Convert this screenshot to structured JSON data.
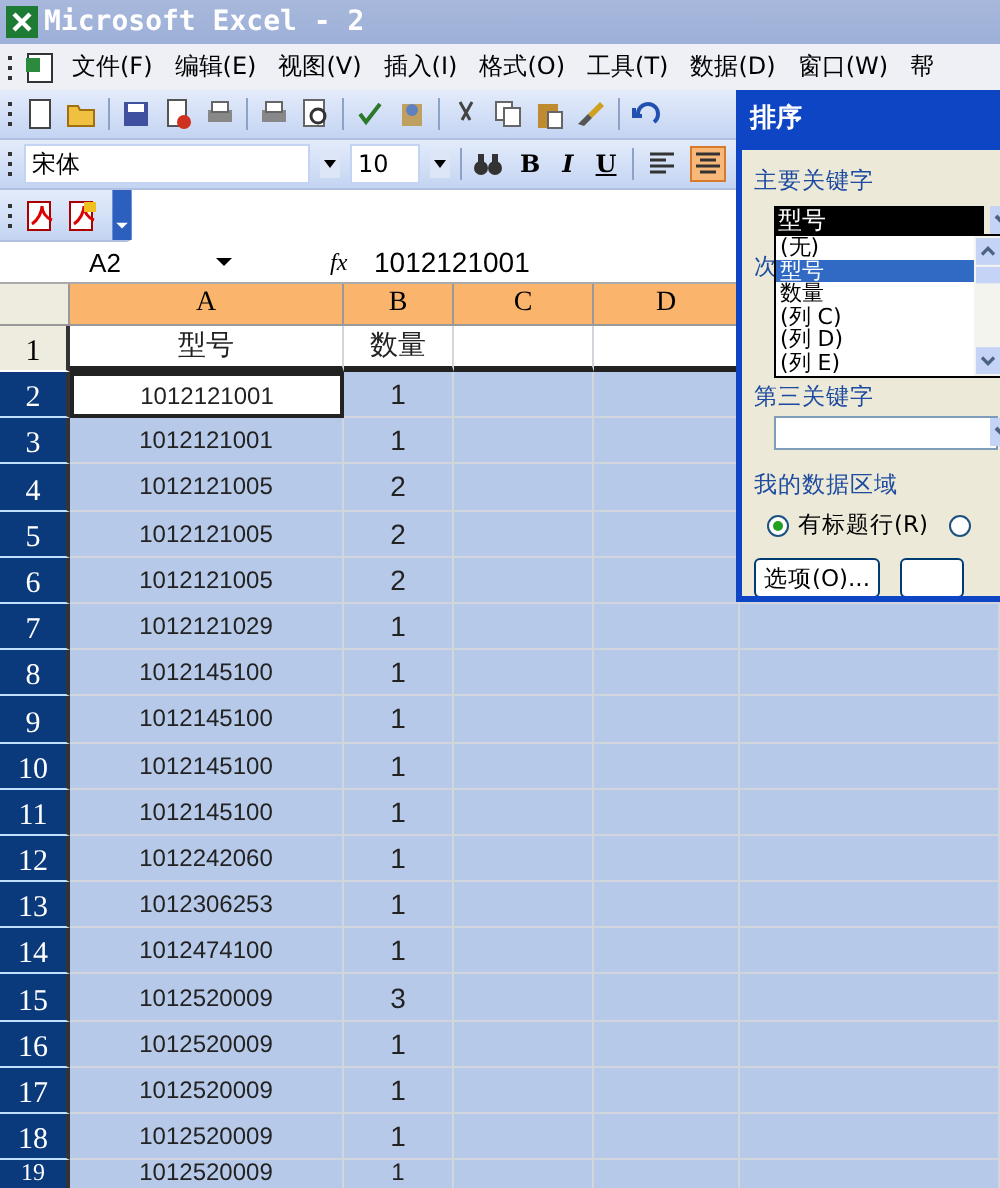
{
  "window": {
    "title": "Microsoft Excel - 2"
  },
  "menu": [
    "文件(F)",
    "编辑(E)",
    "视图(V)",
    "插入(I)",
    "格式(O)",
    "工具(T)",
    "数据(D)",
    "窗口(W)",
    "帮"
  ],
  "format_bar": {
    "font": "宋体",
    "size": "10",
    "styles": [
      "B",
      "I",
      "U"
    ],
    "align": [
      {
        "kind": "left",
        "selected": false
      },
      {
        "kind": "center",
        "selected": true
      }
    ]
  },
  "formula_bar": {
    "name_box": "A2",
    "fx": "fx",
    "value": "1012121001"
  },
  "columns": [
    "A",
    "B",
    "C",
    "D"
  ],
  "rows": [
    {
      "num": "1",
      "a": "型号",
      "b": "数量",
      "selected": false,
      "active": false
    },
    {
      "num": "2",
      "a": "1012121001",
      "b": "1",
      "selected": true,
      "active": true
    },
    {
      "num": "3",
      "a": "1012121001",
      "b": "1",
      "selected": true,
      "active": false
    },
    {
      "num": "4",
      "a": "1012121005",
      "b": "2",
      "selected": true,
      "active": false
    },
    {
      "num": "5",
      "a": "1012121005",
      "b": "2",
      "selected": true,
      "active": false
    },
    {
      "num": "6",
      "a": "1012121005",
      "b": "2",
      "selected": true,
      "active": false
    },
    {
      "num": "7",
      "a": "1012121029",
      "b": "1",
      "selected": true,
      "active": false
    },
    {
      "num": "8",
      "a": "1012145100",
      "b": "1",
      "selected": true,
      "active": false
    },
    {
      "num": "9",
      "a": "1012145100",
      "b": "1",
      "selected": true,
      "active": false
    },
    {
      "num": "10",
      "a": "1012145100",
      "b": "1",
      "selected": true,
      "active": false
    },
    {
      "num": "11",
      "a": "1012145100",
      "b": "1",
      "selected": true,
      "active": false
    },
    {
      "num": "12",
      "a": "1012242060",
      "b": "1",
      "selected": true,
      "active": false
    },
    {
      "num": "13",
      "a": "1012306253",
      "b": "1",
      "selected": true,
      "active": false
    },
    {
      "num": "14",
      "a": "1012474100",
      "b": "1",
      "selected": true,
      "active": false
    },
    {
      "num": "15",
      "a": "1012520009",
      "b": "3",
      "selected": true,
      "active": false
    },
    {
      "num": "16",
      "a": "1012520009",
      "b": "1",
      "selected": true,
      "active": false
    },
    {
      "num": "17",
      "a": "1012520009",
      "b": "1",
      "selected": true,
      "active": false
    },
    {
      "num": "18",
      "a": "1012520009",
      "b": "1",
      "selected": true,
      "active": false
    },
    {
      "num": "19",
      "a": "1012520009",
      "b": "1",
      "selected": true,
      "active": false
    }
  ],
  "sort_dialog": {
    "title": "排序",
    "primary_label": "主要关键字",
    "primary_value": "型号",
    "options": [
      {
        "label": "(无)",
        "selected": false
      },
      {
        "label": "型号",
        "selected": true
      },
      {
        "label": "数量",
        "selected": false
      },
      {
        "label": "(列 C)",
        "selected": false
      },
      {
        "label": "(列 D)",
        "selected": false
      },
      {
        "label": "(列 E)",
        "selected": false
      }
    ],
    "secondary_label": "次",
    "tertiary_label": "第三关键字",
    "range_label": "我的数据区域",
    "radios": [
      {
        "label": "有标题行(R)",
        "selected": true
      },
      {
        "selected": false
      }
    ],
    "options_button": "选项(O)..."
  }
}
